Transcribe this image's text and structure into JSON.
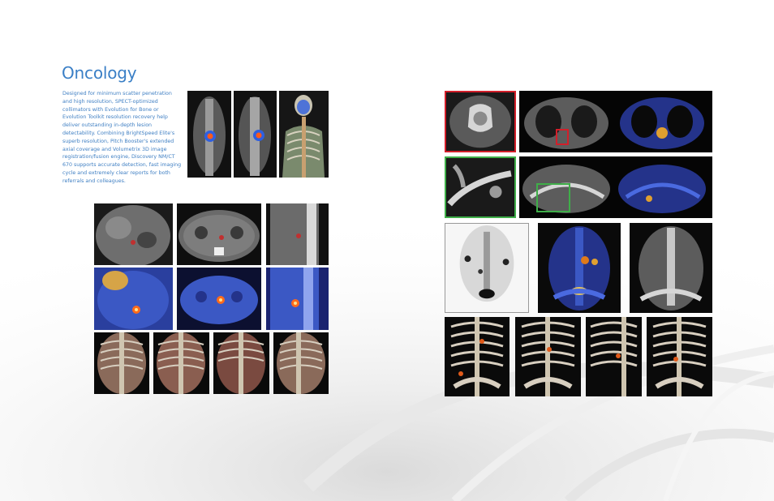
{
  "page": {
    "title": "Oncology",
    "description": "Designed for minimum scatter penetration and high resolution, SPECT-optimized collimators with Evolution for Bone or Evolution Toolkit resolution recovery help deliver outstanding in-depth lesion detectability. Combining BrightSpeed Elite's superb resolution, Pitch Booster's extended axial coverage and Volumetrix 3D image registration/fusion engine, Discovery NM/CT 670 supports accurate detection, fast imaging cycle and extremely clear reports for both referrals and colleagues."
  },
  "colors": {
    "title": "#3a7fc6",
    "body_text": "#3f7fc3",
    "highlight_red": "#d21f2a",
    "highlight_green": "#3fae49"
  }
}
